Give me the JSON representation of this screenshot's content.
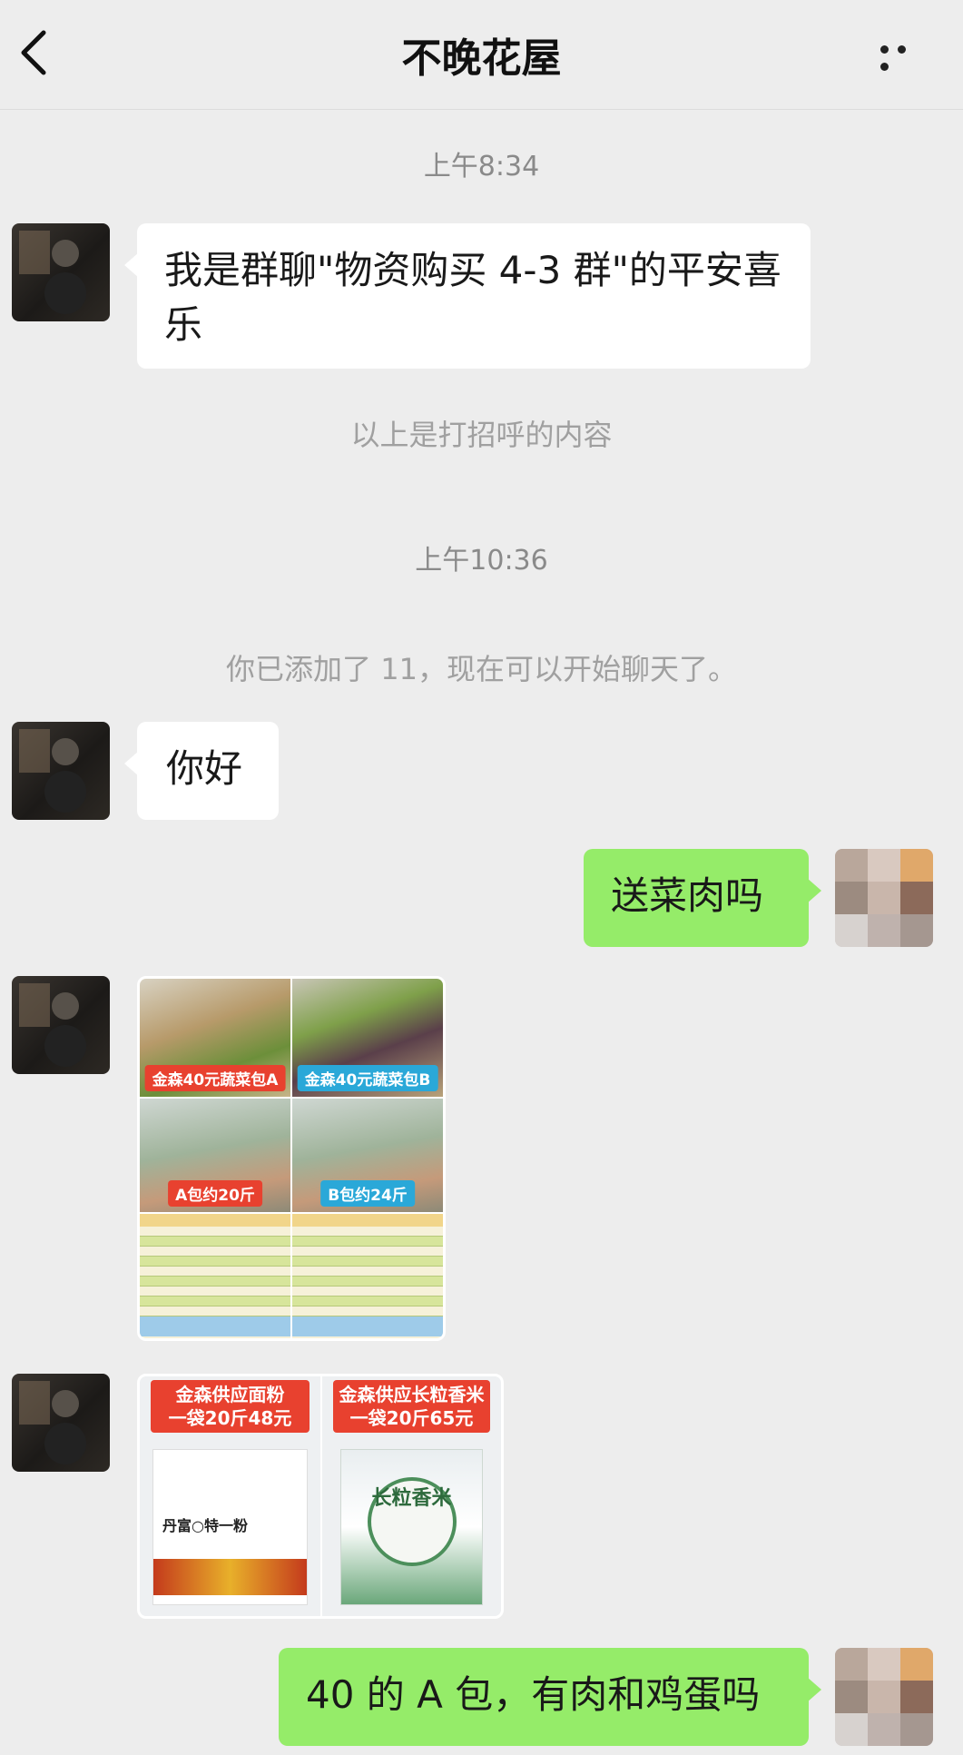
{
  "header": {
    "title": "不晚花屋"
  },
  "messages": {
    "time_1": "上午8:34",
    "greeting": "我是群聊\"物资购买 4-3 群\"的平安喜乐",
    "sys_1": "以上是打招呼的内容",
    "time_2": "上午10:36",
    "sys_2": "你已添加了 11，现在可以开始聊天了。",
    "hello": "你好",
    "ask_1": "送菜肉吗",
    "ask_2": "40 的 A 包，有肉和鸡蛋吗"
  },
  "image_1": {
    "tag_a": "金森40元蔬菜包A",
    "tag_b": "金森40元蔬菜包B",
    "weight_a": "A包约20斤",
    "weight_b": "B包约24斤"
  },
  "image_2": {
    "flour_title_1": "金森供应面粉",
    "flour_title_2": "一袋20斤48元",
    "rice_title_1": "金森供应长粒香米",
    "rice_title_2": "一袋20斤65元",
    "flour_brand": "丹富○特一粉",
    "rice_seal": "长粒香米"
  },
  "colors": {
    "background": "#ededed",
    "bubble_sent": "#95ec69",
    "bubble_received": "#ffffff"
  }
}
